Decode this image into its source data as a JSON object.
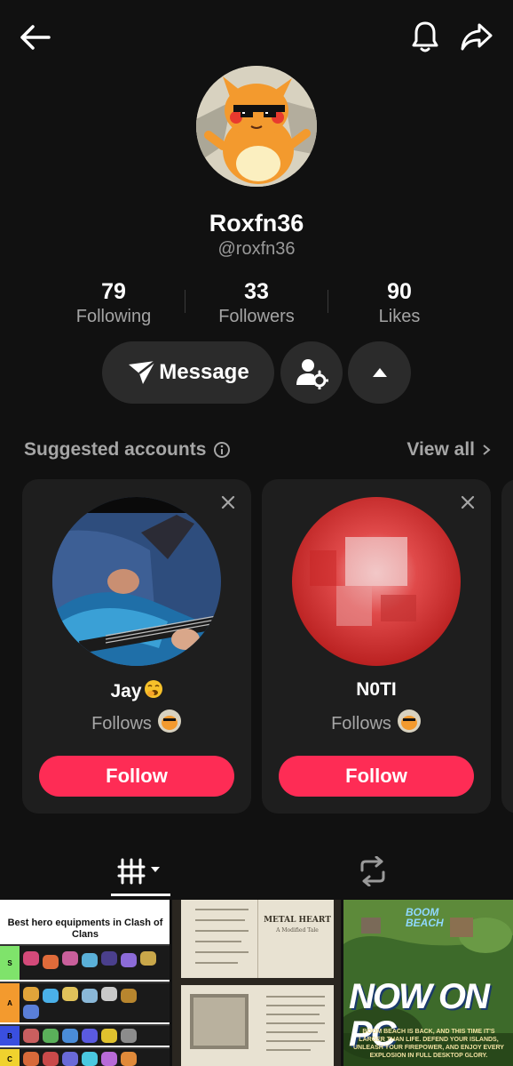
{
  "header": {
    "back_icon": "arrow-left-icon",
    "bell_icon": "bell-icon",
    "share_icon": "share-arrow-icon"
  },
  "profile": {
    "display_name": "Roxfn36",
    "handle": "@roxfn36",
    "stats": [
      {
        "value": "79",
        "label": "Following"
      },
      {
        "value": "33",
        "label": "Followers"
      },
      {
        "value": "90",
        "label": "Likes"
      }
    ],
    "message_label": "Message"
  },
  "suggested": {
    "title": "Suggested accounts",
    "view_all": "View all",
    "cards": [
      {
        "name": "Jay",
        "follows_label": "Follows",
        "button": "Follow"
      },
      {
        "name": "N0TI",
        "follows_label": "Follows",
        "button": "Follow"
      }
    ]
  },
  "thumbnails": {
    "tier_title": "Best hero equipments in Clash of Clans",
    "tier_labels": [
      "S",
      "A",
      "B",
      "C"
    ],
    "doc_heading": "METAL HEART",
    "doc_subheading": "A Modified Tale",
    "game_title_1": "BOOM",
    "game_title_2": "BEACH",
    "game_headline": "NOW ON PC",
    "game_caption": "BOOM BEACH IS BACK, AND THIS TIME IT'S LARGER THAN LIFE. DEFEND YOUR ISLANDS, UNLEASH YOUR FIREPOWER, AND ENJOY EVERY EXPLOSION IN FULL DESKTOP GLORY."
  },
  "colors": {
    "background": "#111111",
    "follow_button": "#fe2c55",
    "secondary_text": "#a6a6a6"
  }
}
